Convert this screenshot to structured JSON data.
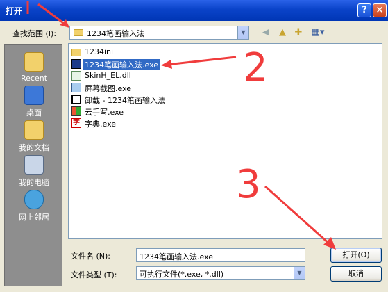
{
  "window": {
    "title": "打开",
    "help_label": "?",
    "close_label": "×"
  },
  "look_in": {
    "label": "查找范围 (I):",
    "value": "1234笔画输入法"
  },
  "toolbar": {
    "back_icon": "back-arrow-icon",
    "up_icon": "up-folder-icon",
    "new_folder_icon": "new-folder-icon",
    "views_icon": "views-menu-icon"
  },
  "places": [
    {
      "label": "Recent",
      "icon": "recent-icon"
    },
    {
      "label": "桌面",
      "icon": "desktop-icon"
    },
    {
      "label": "我的文档",
      "icon": "my-documents-icon"
    },
    {
      "label": "我的电脑",
      "icon": "my-computer-icon"
    },
    {
      "label": "网上邻居",
      "icon": "network-icon"
    }
  ],
  "files": [
    {
      "name": "1234ini",
      "icon": "folder-icon",
      "selected": false
    },
    {
      "name": "1234笔画输入法.exe",
      "icon": "app-icon",
      "selected": true
    },
    {
      "name": "SkinH_EL.dll",
      "icon": "dll-icon",
      "selected": false
    },
    {
      "name": "屏幕截图.exe",
      "icon": "screenshot-icon",
      "selected": false
    },
    {
      "name": "卸载 - 1234笔画输入法",
      "icon": "uninstall-icon",
      "selected": false
    },
    {
      "name": "云手写.exe",
      "icon": "cloud-handwriting-icon",
      "selected": false
    },
    {
      "name": "字典.exe",
      "icon": "dictionary-icon",
      "selected": false
    }
  ],
  "filename": {
    "label": "文件名 (N):",
    "value": "1234笔画输入法.exe"
  },
  "filetype": {
    "label": "文件类型 (T):",
    "value": "可执行文件(*.exe, *.dll)"
  },
  "buttons": {
    "open": "打开(O)",
    "cancel": "取消"
  },
  "annotations": {
    "step2": "2",
    "step3": "3",
    "arrow_color": "#f03c3c"
  }
}
